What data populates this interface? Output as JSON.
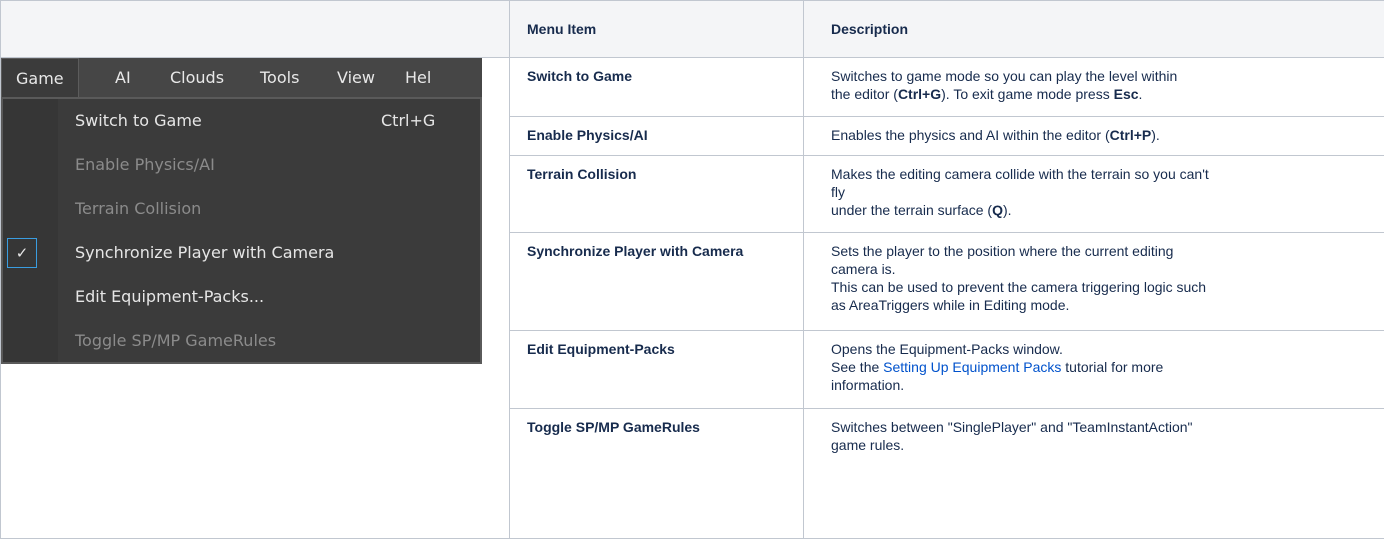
{
  "table": {
    "headers": [
      "",
      "Menu Item",
      "Description"
    ]
  },
  "editor": {
    "menubar": [
      "Game",
      "AI",
      "Clouds",
      "Tools",
      "View",
      "Hel"
    ],
    "items": [
      {
        "label": "Switch to Game",
        "shortcut": "Ctrl+G",
        "enabled": true,
        "checked": false
      },
      {
        "label": "Enable Physics/AI",
        "shortcut": "",
        "enabled": false,
        "checked": false
      },
      {
        "label": "Terrain Collision",
        "shortcut": "",
        "enabled": false,
        "checked": false
      },
      {
        "label": "Synchronize Player with Camera",
        "shortcut": "",
        "enabled": true,
        "checked": true
      },
      {
        "label": "Edit Equipment-Packs...",
        "shortcut": "",
        "enabled": true,
        "checked": false
      },
      {
        "label": "Toggle SP/MP GameRules",
        "shortcut": "",
        "enabled": false,
        "checked": false
      }
    ],
    "checkmark_icon": "checkmark-icon"
  },
  "rows": [
    {
      "item": "Switch to Game",
      "desc": {
        "line1": "Switches to game mode so you can play the level within",
        "line2_pre": "the editor (",
        "line2_bold1": "Ctrl+G",
        "line2_mid": "). To exit game mode press ",
        "line2_bold2": "Esc",
        "line2_post": "."
      }
    },
    {
      "item": "Enable Physics/AI",
      "desc": {
        "pre": "Enables the physics and AI within the editor (",
        "bold": "Ctrl+P",
        "post": ")."
      }
    },
    {
      "item": "Terrain Collision",
      "desc": {
        "line1": "Makes the editing camera collide with the terrain so you can't",
        "line2": "fly",
        "line3_pre": "under the terrain surface (",
        "line3_bold": "Q",
        "line3_post": ")."
      }
    },
    {
      "item": "Synchronize Player with Camera",
      "desc": {
        "line1": "Sets the player to the position where the current editing",
        "line2": "camera is.",
        "line3": "This can be used to prevent the camera triggering logic such",
        "line4": "as AreaTriggers while in Editing mode."
      }
    },
    {
      "item": "Edit Equipment-Packs",
      "desc": {
        "line1": "Opens the Equipment-Packs window.",
        "line2_pre": "See the ",
        "line2_link": "Setting Up Equipment Packs",
        "line2_post": " tutorial for more",
        "line3": "information."
      }
    },
    {
      "item": "Toggle SP/MP GameRules",
      "desc": {
        "line1": "Switches between \"SinglePlayer\" and \"TeamInstantAction\"",
        "line2": "game rules."
      }
    }
  ],
  "colors": {
    "border": "#c1c7d0",
    "header_bg": "#f4f5f7",
    "link": "#0052cc",
    "menu_bg": "#3b3b3b",
    "checkbox_border": "#3a9de0"
  }
}
